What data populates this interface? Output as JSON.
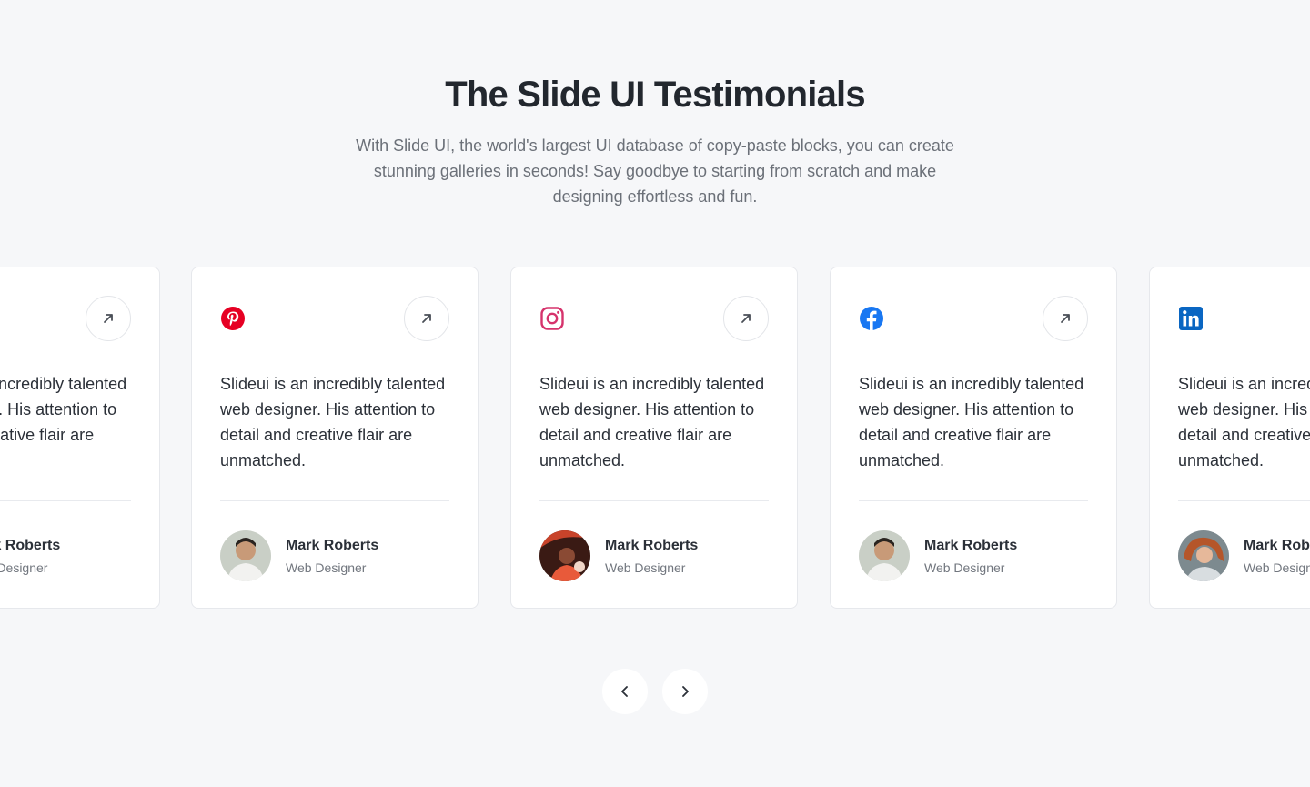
{
  "header": {
    "title": "The Slide UI Testimonials",
    "subtitle": "With Slide UI, the world's largest UI database of copy-paste blocks, you can create stunning galleries in seconds! Say goodbye to starting from scratch and make designing effortless and fun."
  },
  "cards": [
    {
      "brand": "unknown",
      "brand_icon": "none",
      "quote": "Slideui is an incredibly talented web designer. His attention to detail and creative flair are unmatched.",
      "name": "Mark Roberts",
      "role": "Web Designer",
      "avatar": "avatar-man-smiling"
    },
    {
      "brand": "pinterest",
      "brand_icon": "pinterest-icon",
      "brand_color": "#e60023",
      "quote": "Slideui is an incredibly talented web designer. His attention to detail and creative flair are unmatched.",
      "name": "Mark Roberts",
      "role": "Web Designer",
      "avatar": "avatar-man-smiling"
    },
    {
      "brand": "instagram",
      "brand_icon": "instagram-icon",
      "brand_color": "#d6336c",
      "quote": "Slideui is an incredibly talented web designer. His attention to detail and creative flair are unmatched.",
      "name": "Mark Roberts",
      "role": "Web Designer",
      "avatar": "avatar-woman-red-hat"
    },
    {
      "brand": "facebook",
      "brand_icon": "facebook-icon",
      "brand_color": "#1877f2",
      "quote": "Slideui is an incredibly talented web designer. His attention to detail and creative flair are unmatched.",
      "name": "Mark Roberts",
      "role": "Web Designer",
      "avatar": "avatar-man-smiling"
    },
    {
      "brand": "linkedin",
      "brand_icon": "linkedin-icon",
      "brand_color": "#0a66c2",
      "quote": "Slideui is an incredibly talented web designer. His attention to detail and creative flair are unmatched.",
      "name": "Mark Roberts",
      "role": "Web Designer",
      "avatar": "avatar-woman-red-hair"
    }
  ],
  "card_action_icon": "arrow-up-right-icon",
  "navigation": {
    "prev_icon": "chevron-left-icon",
    "next_icon": "chevron-right-icon"
  },
  "colors": {
    "background": "#f6f7f9",
    "card": "#ffffff",
    "card_border": "#e6e8ec",
    "heading": "#22272e",
    "body_text": "#2b3038",
    "muted_text": "#6b7078"
  }
}
